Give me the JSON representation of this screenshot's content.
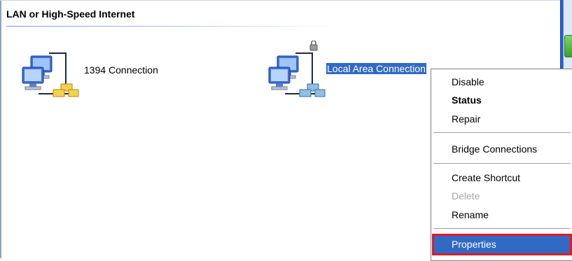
{
  "section": {
    "title": "LAN or High-Speed Internet"
  },
  "connections": [
    {
      "name": "1394 Connection",
      "icon": "network-connection-icon"
    },
    {
      "name": "Local Area Connection",
      "icon": "network-connection-icon",
      "selected": true
    }
  ],
  "context_menu": {
    "items": [
      {
        "label": "Disable"
      },
      {
        "label": "Status",
        "bold": true
      },
      {
        "label": "Repair"
      },
      {
        "label": "Bridge Connections"
      },
      {
        "label": "Create Shortcut"
      },
      {
        "label": "Delete",
        "disabled": true
      },
      {
        "label": "Rename"
      },
      {
        "label": "Properties",
        "highlighted": true
      }
    ]
  },
  "colors": {
    "selection": "#316ac5",
    "highlight_outline": "#e01b24",
    "accent": "#2a5fd4"
  }
}
